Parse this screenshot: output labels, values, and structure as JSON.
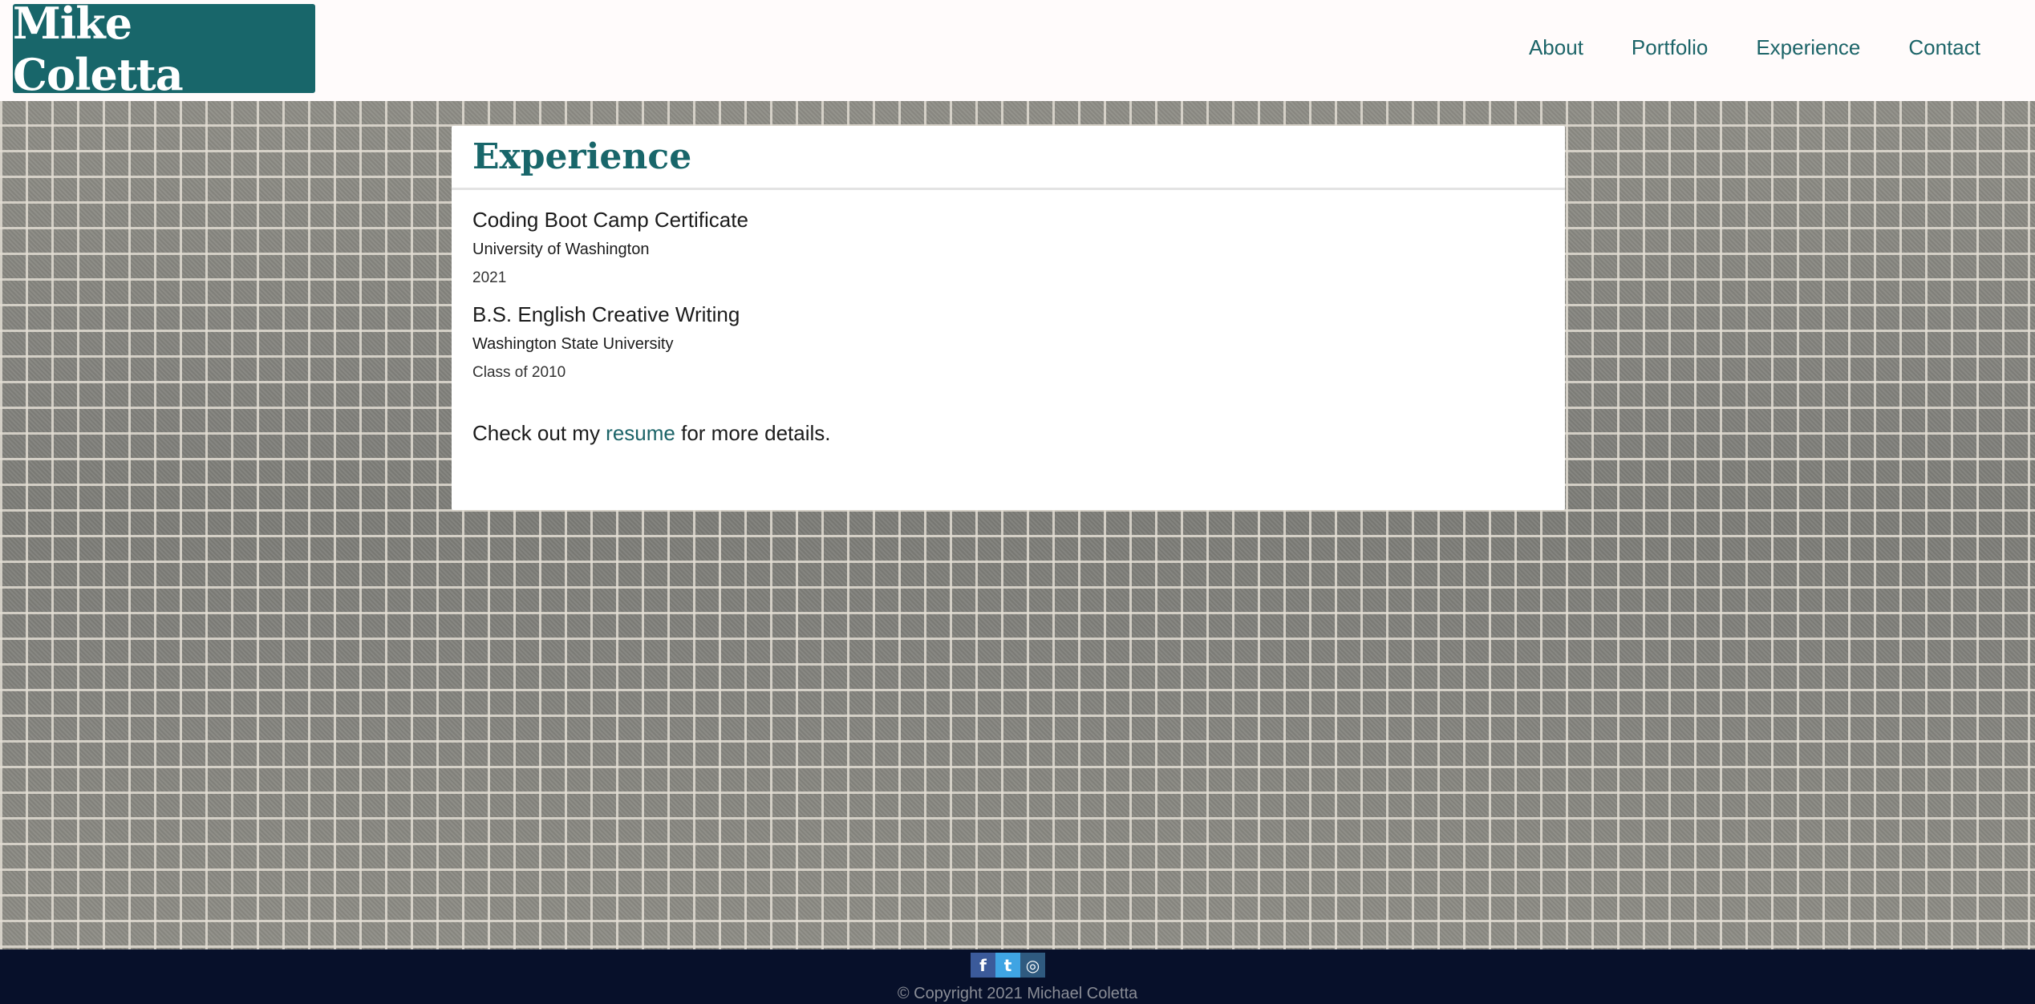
{
  "header": {
    "logo_text": "Mike Coletta",
    "nav": [
      {
        "label": "About"
      },
      {
        "label": "Portfolio"
      },
      {
        "label": "Experience"
      },
      {
        "label": "Contact"
      }
    ]
  },
  "main": {
    "title": "Experience",
    "entries": [
      {
        "title": "Coding Boot Camp Certificate",
        "school": "University of Washington",
        "date": "2021"
      },
      {
        "title": "B.S. English Creative Writing",
        "school": "Washington State University",
        "date": "Class of 2010"
      }
    ],
    "resume": {
      "prefix": "Check out my ",
      "link_label": "resume",
      "suffix": " for more details."
    }
  },
  "footer": {
    "social": [
      {
        "icon": "facebook-icon",
        "glyph": "f"
      },
      {
        "icon": "twitter-icon",
        "glyph": "t"
      },
      {
        "icon": "instagram-icon",
        "glyph": "◎"
      }
    ],
    "copyright": "© Copyright 2021 Michael Coletta"
  },
  "colors": {
    "brand_teal": "#18666a",
    "footer_bg": "#07102a",
    "header_bg": "#fffbfb"
  }
}
